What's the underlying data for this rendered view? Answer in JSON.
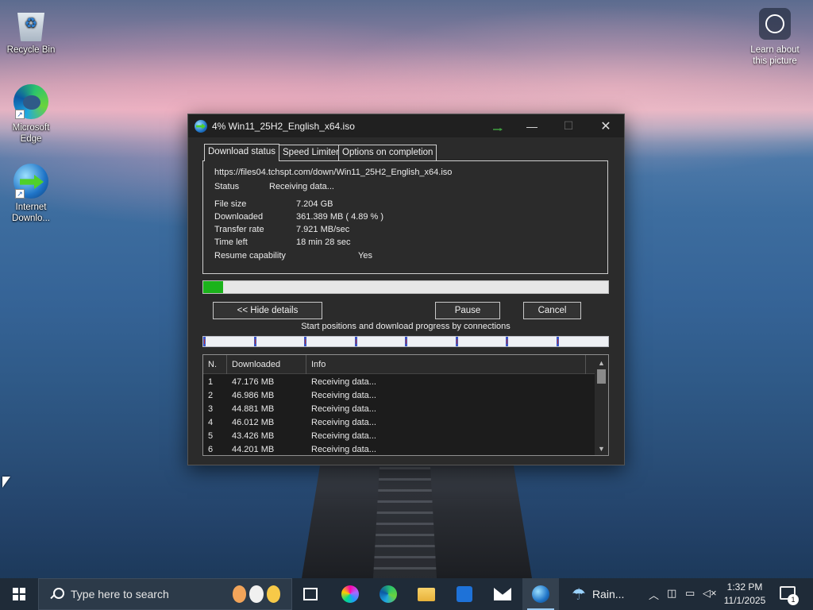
{
  "desktop": {
    "icons": [
      {
        "label": "Recycle Bin"
      },
      {
        "label": "Microsoft Edge"
      },
      {
        "label": "Internet Downlo..."
      }
    ],
    "learn_label": "Learn about this picture"
  },
  "window": {
    "title": "4% Win11_25H2_English_x64.iso",
    "tabs": [
      "Download status",
      "Speed Limiter",
      "Options on completion"
    ],
    "url": "https://files04.tchspt.com/down/Win11_25H2_English_x64.iso",
    "status_label": "Status",
    "status_value": "Receiving data...",
    "fields": [
      {
        "label": "File size",
        "value": "7.204  GB"
      },
      {
        "label": "Downloaded",
        "value": "361.389  MB  ( 4.89 % )"
      },
      {
        "label": "Transfer rate",
        "value": "7.921  MB/sec"
      },
      {
        "label": "Time left",
        "value": "18 min 28 sec"
      }
    ],
    "resume_label": "Resume capability",
    "resume_value": "Yes",
    "progress_percent": 4.89,
    "buttons": {
      "hide_details": "<< Hide details",
      "pause": "Pause",
      "cancel": "Cancel"
    },
    "connections_caption": "Start positions and download progress by connections",
    "connection_start_fractions": [
      0,
      0.125,
      0.25,
      0.375,
      0.5,
      0.625,
      0.75,
      0.875
    ],
    "columns": [
      "N.",
      "Downloaded",
      "Info"
    ],
    "rows": [
      {
        "n": "1",
        "downloaded": "47.176  MB",
        "info": "Receiving data..."
      },
      {
        "n": "2",
        "downloaded": "46.986  MB",
        "info": "Receiving data..."
      },
      {
        "n": "3",
        "downloaded": "44.881  MB",
        "info": "Receiving data..."
      },
      {
        "n": "4",
        "downloaded": "46.012  MB",
        "info": "Receiving data..."
      },
      {
        "n": "5",
        "downloaded": "43.426  MB",
        "info": "Receiving data..."
      },
      {
        "n": "6",
        "downloaded": "44.201  MB",
        "info": "Receiving data..."
      }
    ]
  },
  "taskbar": {
    "search_placeholder": "Type here to search",
    "weather": "Rain...",
    "time": "1:32 PM",
    "date": "11/1/2025",
    "notification_count": "1"
  },
  "colors": {
    "progress_fill": "#1bb31b",
    "window_bg": "#2b2b2b",
    "taskbar_bg": "#1f2b38"
  }
}
